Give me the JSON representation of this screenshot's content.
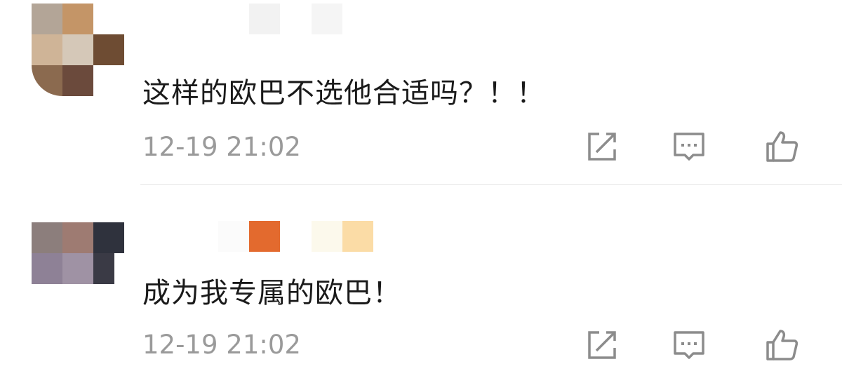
{
  "comments": [
    {
      "text": "这样的欧巴不选他合适吗？！！",
      "time": "12-19 21:02",
      "avatar_pixels": [
        [
          "#b3a597",
          "#c49567",
          "#ffffff"
        ],
        [
          "#cfb497",
          "#d5c8b8",
          "#6e4c33"
        ],
        [
          "#8b6a4f",
          "#6b4a3c",
          "#ffffff"
        ]
      ],
      "name_blocks": [
        "#f2f2f2",
        "#f5f5f5"
      ]
    },
    {
      "text": "成为我专属的欧巴！",
      "time": "12-19 21:02",
      "avatar_pixels": [
        [
          "#8c7e7c",
          "#9e7b72",
          "#2f323d"
        ],
        [
          "#8e8196",
          "#9f92a4",
          "#3a3a45"
        ]
      ],
      "name_blocks": [
        "#fbfbfb",
        "#e36a2e",
        "#fcf9ec",
        "#fbdca6"
      ]
    }
  ],
  "icons": {
    "repost": "repost-icon",
    "reply": "reply-icon",
    "like": "like-icon"
  },
  "colors": {
    "text": "#1a1a1a",
    "time": "#9a9a9a",
    "icon": "#8c8c8c",
    "divider": "#e6e6e6"
  }
}
